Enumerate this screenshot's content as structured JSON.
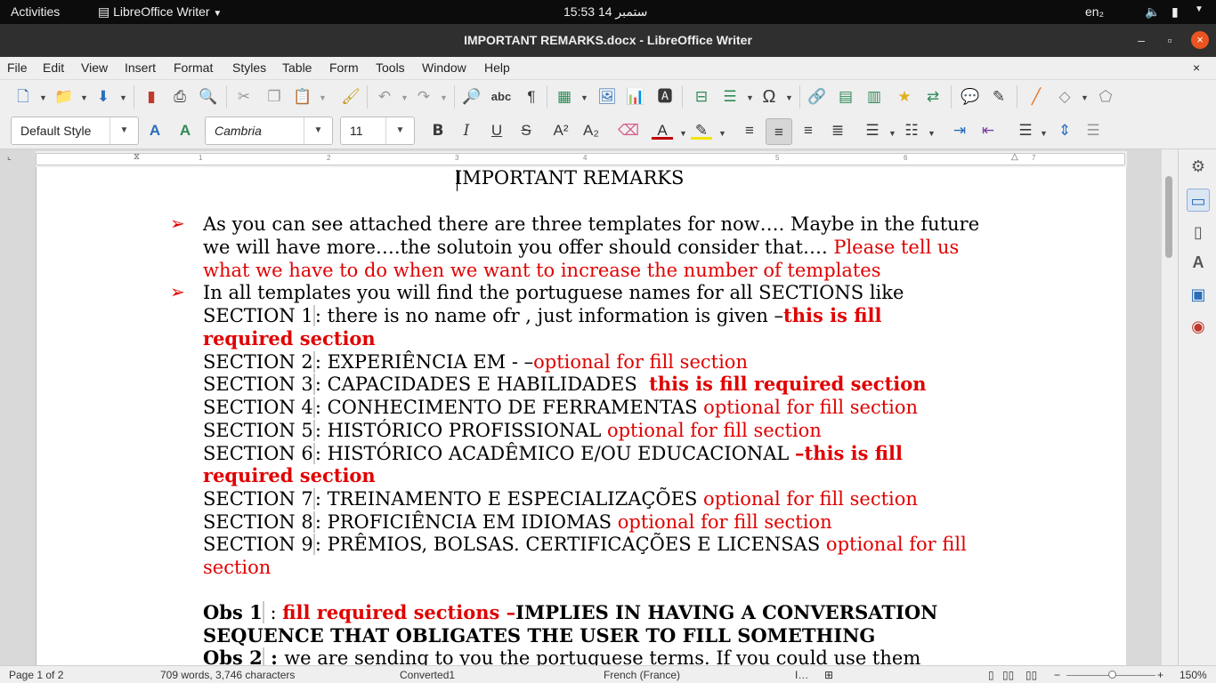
{
  "topbar": {
    "activities": "Activities",
    "app": "LibreOffice Writer",
    "time": "15:53",
    "date": "14 ستمبر",
    "lang": "en₂"
  },
  "window": {
    "title": "IMPORTANT REMARKS.docx - LibreOffice Writer",
    "minimize": "–",
    "maximize": "▫",
    "close": "×"
  },
  "menu": [
    "File",
    "Edit",
    "View",
    "Insert",
    "Format",
    "Styles",
    "Table",
    "Form",
    "Tools",
    "Window",
    "Help"
  ],
  "menu_close": "×",
  "format": {
    "style": "Default Style",
    "font": "Cambria",
    "size": "11"
  },
  "ruler": [
    "1",
    "2",
    "3",
    "4",
    "5",
    "6",
    "7"
  ],
  "doc": {
    "heading": "IMPORTANT REMARKS",
    "bullet": "➢",
    "l1": "As you can see attached there are three templates for now…. Maybe in the future",
    "l2a": "we will have more….the solutoin you offer should consider that…. ",
    "l2b": "Please tell us",
    "l3": "what we have to do when we want to increase the number of templates",
    "l4": "In all templates you will find the portuguese names for all SECTIONS like",
    "s1a": "SECTION 1",
    "s1b": ": there is no name ofr , just information is given –",
    "s1c": "this is fill",
    "s1d": "required section",
    "s2a": "SECTION 2",
    "s2b": ": EXPERIÊNCIA EM - –",
    "s2c": "optional for fill section",
    "s3a": "SECTION 3",
    "s3b": ": CAPACIDADES E HABILIDADES  ",
    "s3c": "this is fill required section",
    "s4a": "SECTION 4",
    "s4b": ": CONHECIMENTO DE FERRAMENTAS ",
    "s4c": "optional for fill section",
    "s5a": "SECTION 5",
    "s5b": ": HISTÓRICO PROFISSIONAL ",
    "s5c": "optional for fill section",
    "s6a": "SECTION 6",
    "s6b": ": HISTÓRICO ACADÊMICO E/OU EDUCACIONAL ",
    "s6c": "–this is fill",
    "s6d": "required section",
    "s7a": "SECTION 7",
    "s7b": ": TREINAMENTO E ESPECIALIZAÇÕES ",
    "s7c": "optional for fill section",
    "s8a": "SECTION 8",
    "s8b": ": PROFICIÊNCIA EM IDIOMAS ",
    "s8c": "optional for fill section",
    "s9a": "SECTION 9",
    "s9b": ": PRÊMIOS, BOLSAS. CERTIFICAÇÕES E LICENSAS ",
    "s9c": "optional for fill",
    "s9d": "section",
    "o1a": "Obs 1",
    "o1b": " : ",
    "o1c": "fill required sections –",
    "o1d": "IMPLIES IN HAVING A CONVERSATION",
    "o1e": "SEQUENCE THAT OBLIGATES THE USER TO FILL SOMETHING",
    "o2a": "Obs 2",
    "o2b": " : ",
    "o2c": "we are sending to you the portuguese terms. If you could use them"
  },
  "status": {
    "page": "Page 1 of 2",
    "words": "709 words, 3,746 characters",
    "style": "Converted1",
    "lang": "French (France)",
    "zoom": "150%"
  },
  "colors": {
    "accent": "#e95420",
    "red_text": "#e00000"
  }
}
